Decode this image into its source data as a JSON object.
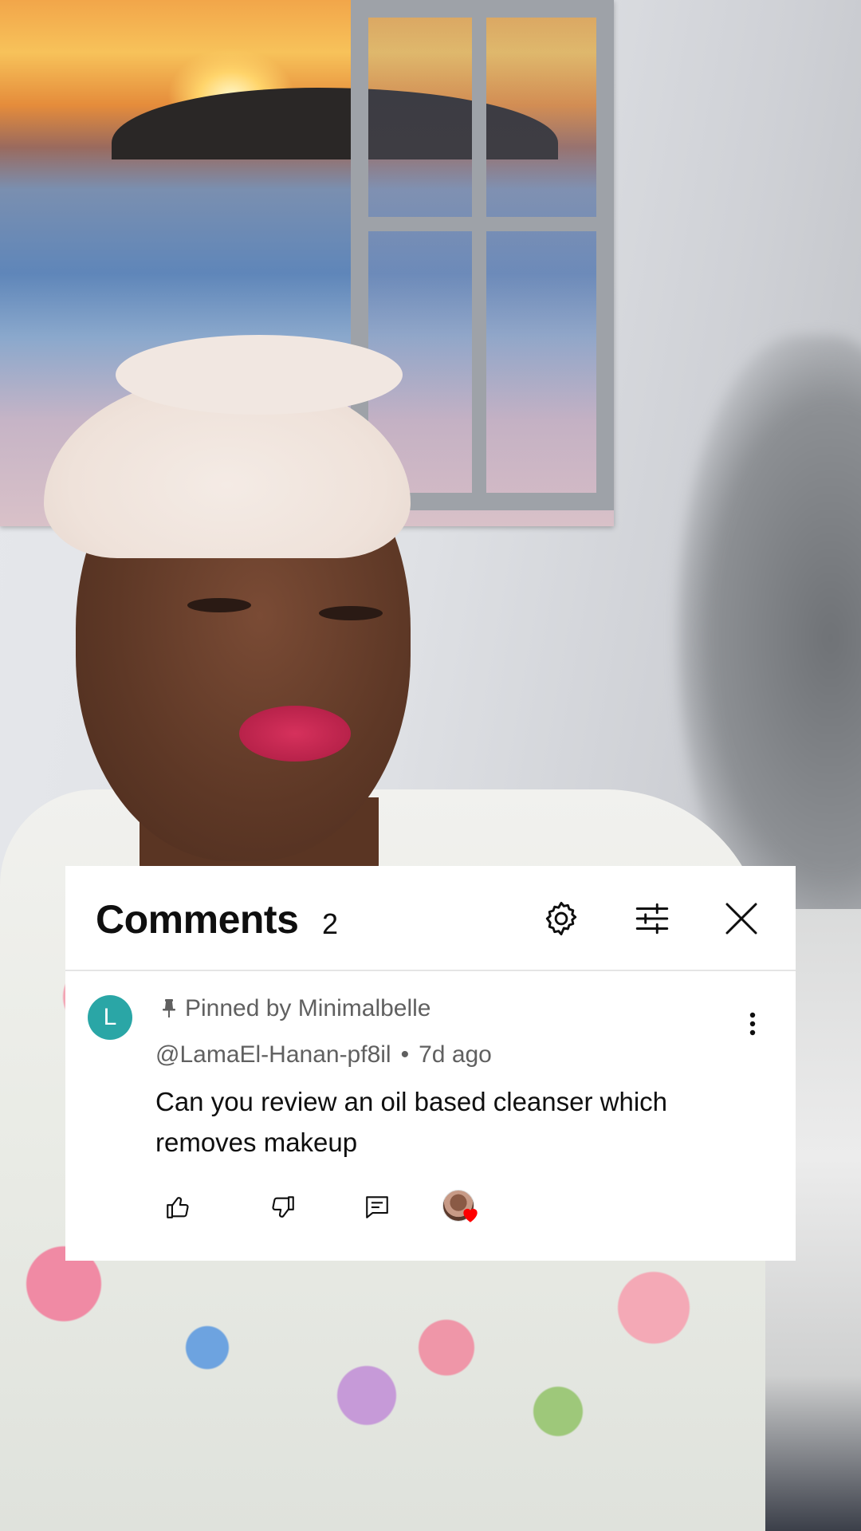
{
  "comments_panel": {
    "title": "Comments",
    "count": "2",
    "settings_icon": "gear-icon",
    "filter_icon": "sliders-icon",
    "close_icon": "close-icon"
  },
  "comment": {
    "avatar_letter": "L",
    "avatar_color": "#2aa6a6",
    "pinned_label": "Pinned by Minimalbelle",
    "author": "@LamaEl-Hanan-pf8il",
    "separator": "•",
    "time": "7d ago",
    "text": "Can you review an oil based cleanser which removes makeup",
    "actions": [
      "like-icon",
      "dislike-icon",
      "reply-icon",
      "creator-heart-icon"
    ],
    "heart_color": "#ff0000"
  }
}
